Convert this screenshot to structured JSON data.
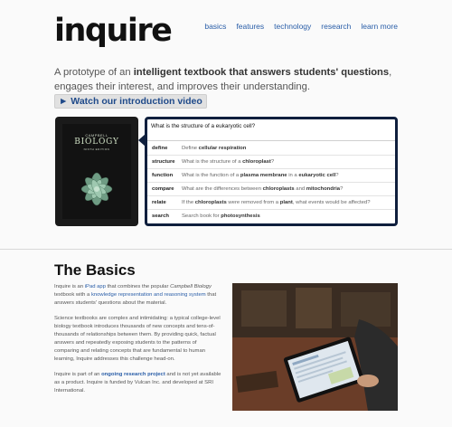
{
  "header": {
    "logo_text": "inquire",
    "nav": [
      "basics",
      "features",
      "technology",
      "research",
      "learn more"
    ]
  },
  "intro": {
    "text_1": "A prototype of an ",
    "text_2": "intelligent textbook that answers students' questions",
    "text_3": ", engages their interest, and improves their understanding. ",
    "video_button": "► Watch our introduction video"
  },
  "book": {
    "publisher_line": "CAMPBELL",
    "title": "BIOLOGY",
    "edition_line": "NINTH EDITION"
  },
  "query": {
    "input_value": "What is the structure of a eukaryotic cell?",
    "suggestions": [
      {
        "cmd": "define",
        "parts": [
          "Define ",
          "cellular respiration"
        ]
      },
      {
        "cmd": "structure",
        "parts": [
          "What is the structure of a ",
          "chloroplast",
          "?"
        ]
      },
      {
        "cmd": "function",
        "parts": [
          "What is the function of a ",
          "plasma membrane",
          " in a ",
          "eukaryotic cell",
          "?"
        ]
      },
      {
        "cmd": "compare",
        "parts": [
          "What are the differences between ",
          "chloroplasts",
          " and ",
          "mitochondria",
          "?"
        ]
      },
      {
        "cmd": "relate",
        "parts": [
          "If the ",
          "chloroplasts",
          " were removed from a ",
          "plant",
          ", what events would be affected?"
        ]
      },
      {
        "cmd": "search",
        "parts": [
          "Search book for ",
          "photosynthesis"
        ]
      }
    ]
  },
  "basics": {
    "title": "The Basics",
    "p1": {
      "a": "Inquire is an ",
      "link1": "iPad app",
      "b": " that combines the popular ",
      "c_italic": "Campbell Biology",
      "d": " textbook with a ",
      "link2": "knowledge representation and reasoning system",
      "e": " that answers students' questions about the material."
    },
    "p2": "Science textbooks are complex and intimidating: a typical college-level biology textbook introduces thousands of new concepts and tens-of-thousands of relationships between them. By providing quick, factual answers and repeatedly exposing students to the patterns of comparing and relating concepts that are fundamental to human learning, Inquire addresses this challenge head-on.",
    "p3": {
      "a": "Inquire is part of an ",
      "link": "ongoing research project",
      "b": " and is not yet available as a product. Inquire is funded by Vulcan Inc. and developed at SRI International."
    }
  },
  "colors": {
    "link": "#2a5ea8",
    "query_border": "#0f1f3d",
    "video_button_bg": "#e1e1e1"
  }
}
